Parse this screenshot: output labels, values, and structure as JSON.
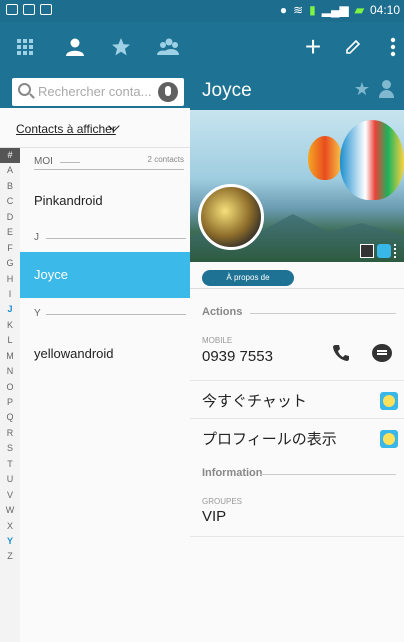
{
  "status": {
    "time": "04:10"
  },
  "colors": {
    "primary": "#1e7294",
    "selected": "#3bb9e8",
    "accent_letter": "#1d8fd0"
  },
  "toolbar": {
    "icons": [
      "dialpad-icon",
      "contacts-icon",
      "favorites-icon",
      "groups-icon",
      "add-icon",
      "edit-icon",
      "more-icon"
    ]
  },
  "search": {
    "placeholder": "Rechercher conta..."
  },
  "filter": {
    "label": "Contacts à afficher"
  },
  "alphabet": [
    "#",
    "A",
    "B",
    "C",
    "D",
    "E",
    "F",
    "G",
    "H",
    "I",
    "J",
    "K",
    "L",
    "M",
    "N",
    "O",
    "P",
    "Q",
    "R",
    "S",
    "T",
    "U",
    "V",
    "W",
    "X",
    "Y",
    "Z"
  ],
  "contacts": {
    "sections": [
      {
        "header": "MOI",
        "count": "2 contacts",
        "items": [
          "Pinkandroid"
        ]
      },
      {
        "header": "J",
        "items": [
          "Joyce"
        ]
      },
      {
        "header": "Y",
        "items": [
          "yellowandroid"
        ]
      }
    ],
    "selected": "Joyce"
  },
  "detail": {
    "name": "Joyce",
    "tab": "À propos de",
    "actions_header": "Actions",
    "mobile_label": "MOBILE",
    "mobile_number": "0939 7553",
    "chat_now": "今すぐチャット",
    "view_profile": "プロフィールの表示",
    "info_header": "Information",
    "groups_label": "GROUPES",
    "groups_value": "VIP"
  }
}
